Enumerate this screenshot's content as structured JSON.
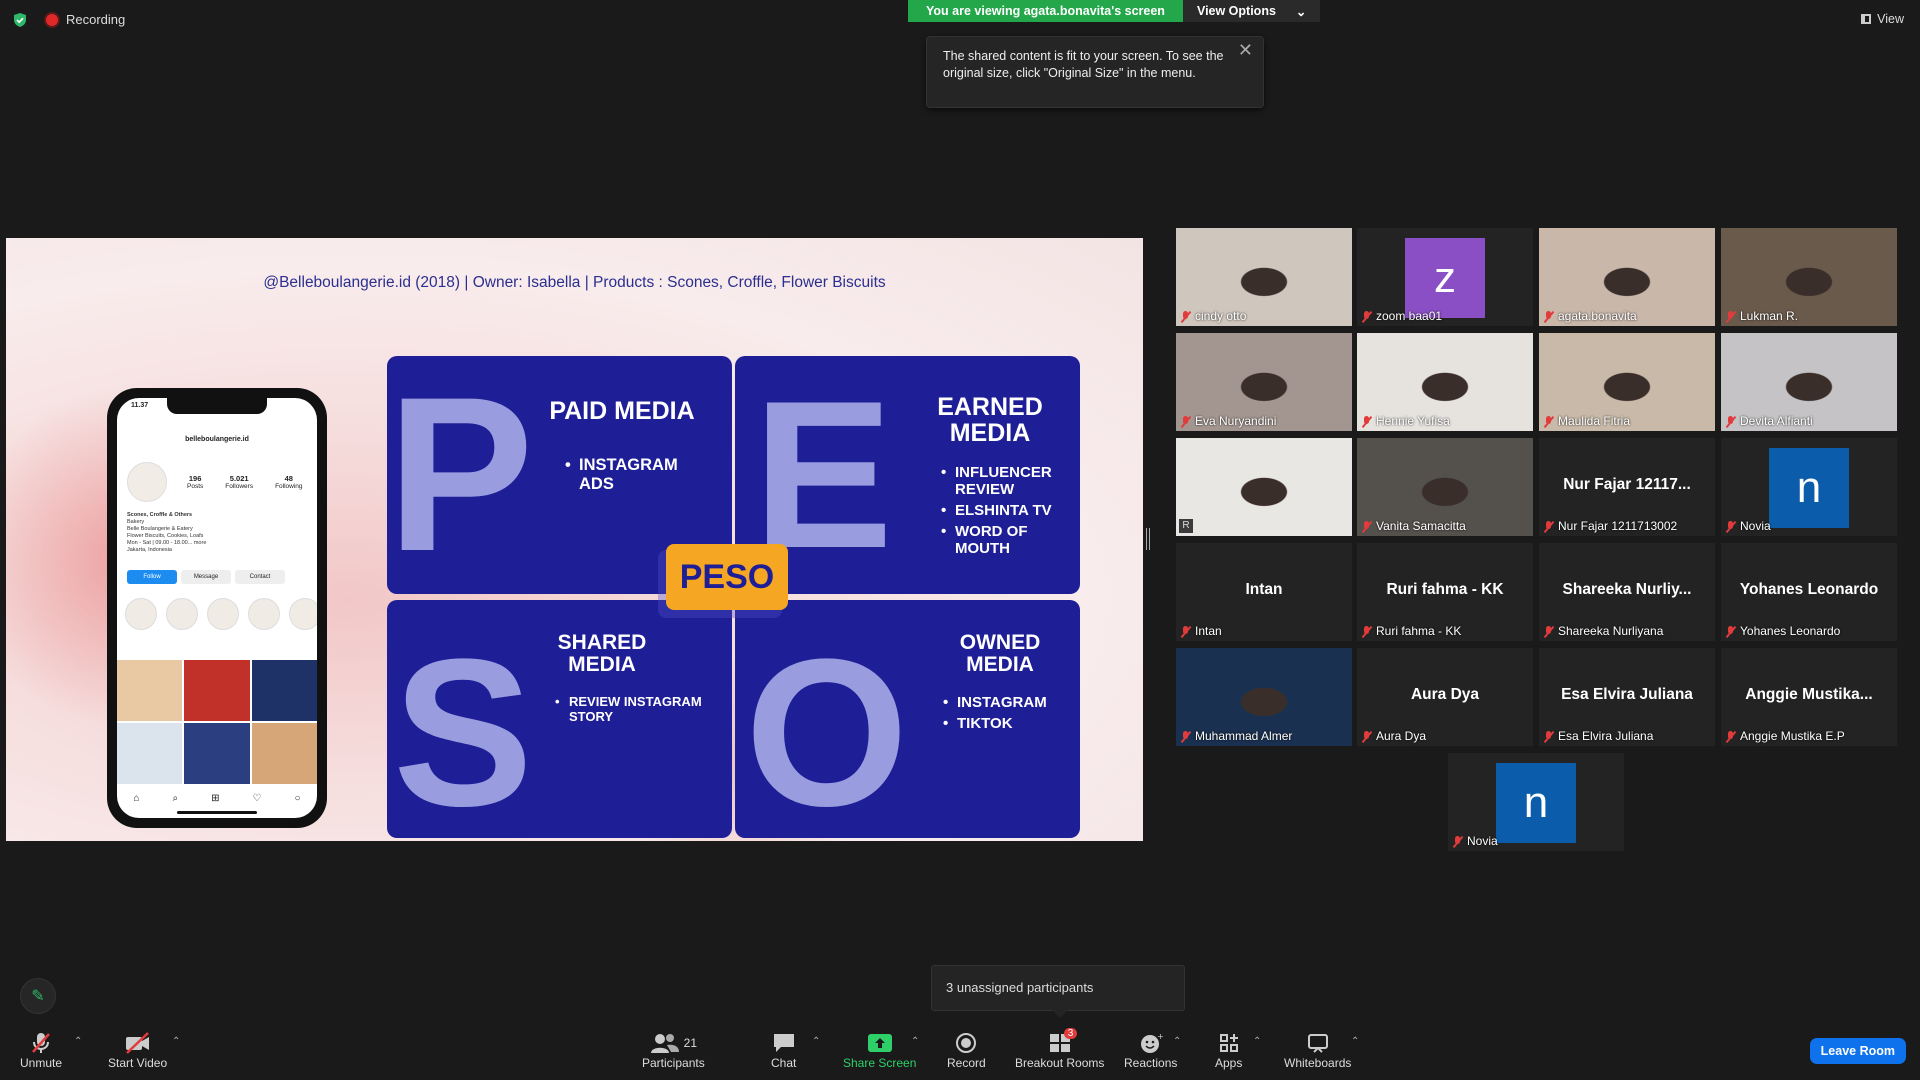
{
  "top": {
    "recording": "Recording",
    "viewing_banner": "You are viewing agata.bonavita's screen",
    "view_options": "View Options",
    "view": "View",
    "tooltip": "The shared content is fit to your screen. To see the original size, click \"Original Size\" in the menu."
  },
  "slide": {
    "title": "@Belleboulangerie.id (2018)  | Owner: Isabella | Products : Scones, Croffle, Flower Biscuits",
    "phone": {
      "time": "11.37",
      "handle": "belleboulangerie.id",
      "posts": "196",
      "posts_label": "Posts",
      "followers": "5.021",
      "followers_label": "Followers",
      "following": "48",
      "following_label": "Following",
      "bio1": "Scones, Croffle & Others",
      "bio2": "Bakery",
      "bio3": "Belle Boulangerie & Eatery",
      "bio4": "Flower Biscuits, Cookies, Loafs",
      "bio5": "Mon - Sat | 09.00 - 18.00... more",
      "bio6": "Jakarta, Indonesia",
      "btn_follow": "Follow",
      "btn_message": "Message",
      "btn_contact": "Contact"
    },
    "p": {
      "letter": "P",
      "title": "PAID MEDIA",
      "items": [
        "INSTAGRAM ADS"
      ]
    },
    "e": {
      "letter": "E",
      "title": "EARNED MEDIA",
      "items": [
        "INFLUENCER REVIEW",
        "ELSHINTA TV",
        "WORD OF MOUTH"
      ]
    },
    "s": {
      "letter": "S",
      "title": "SHARED MEDIA",
      "items": [
        "REVIEW INSTAGRAM STORY"
      ]
    },
    "o": {
      "letter": "O",
      "title": "OWNED MEDIA",
      "items": [
        "INSTAGRAM",
        "TIKTOK"
      ]
    },
    "center": "PESO"
  },
  "participants": [
    {
      "name": "cindy otto",
      "type": "video",
      "color": "#cfc6bd"
    },
    {
      "name": "zoom baa01",
      "type": "letter",
      "letter": "z",
      "color": "#8a4fc4"
    },
    {
      "name": "agata.bonavita",
      "type": "video",
      "color": "#c9b7aa"
    },
    {
      "name": "Lukman R.",
      "type": "video",
      "color": "#6a5a4c"
    },
    {
      "name": "Eva Nuryandini",
      "type": "video",
      "color": "#a39690"
    },
    {
      "name": "Hennie Yufisa",
      "type": "video",
      "color": "#e6e3df"
    },
    {
      "name": "Maulida Fitria",
      "type": "video",
      "color": "#c8b9a8"
    },
    {
      "name": "Devita Alfianti",
      "type": "video",
      "color": "#c5c3c5"
    },
    {
      "name": "R",
      "type": "video",
      "color": "#e9e7e4"
    },
    {
      "name": "Vanita Samacitta",
      "type": "video",
      "color": "#54504c"
    },
    {
      "name": "Nur Fajar 1211713002",
      "type": "text",
      "display": "Nur Fajar 12117..."
    },
    {
      "name": "Novia",
      "type": "letter",
      "letter": "n",
      "color": "#0b5cab"
    },
    {
      "name": "Intan",
      "type": "text",
      "display": "Intan"
    },
    {
      "name": "Ruri fahma - KK",
      "type": "text",
      "display": "Ruri fahma - KK"
    },
    {
      "name": "Shareeka Nurliyana",
      "type": "text",
      "display": "Shareeka  Nurliy..."
    },
    {
      "name": "Yohanes Leonardo",
      "type": "text",
      "display": "Yohanes Leonardo"
    },
    {
      "name": "Muhammad Almer",
      "type": "video",
      "color": "#1a3050"
    },
    {
      "name": "Aura Dya",
      "type": "text",
      "display": "Aura Dya"
    },
    {
      "name": "Esa Elvira Juliana",
      "type": "text",
      "display": "Esa Elvira Juliana"
    },
    {
      "name": "Anggie Mustika E.P",
      "type": "text",
      "display": "Anggie  Mustika..."
    },
    {
      "name": "Novia",
      "type": "letter",
      "letter": "n",
      "color": "#0b5cab"
    }
  ],
  "unassigned": "3 unassigned participants",
  "toolbar": {
    "unmute": "Unmute",
    "start_video": "Start Video",
    "participants": "Participants",
    "participants_count": "21",
    "chat": "Chat",
    "share_screen": "Share Screen",
    "record": "Record",
    "breakout_rooms": "Breakout Rooms",
    "breakout_count": "3",
    "reactions": "Reactions",
    "apps": "Apps",
    "whiteboards": "Whiteboards",
    "leave_room": "Leave Room"
  },
  "colors": {
    "green": "#23a74a",
    "slide_blue": "#1e1e96",
    "peso_orange": "#f5a623",
    "leave_blue": "#0e72ed"
  }
}
